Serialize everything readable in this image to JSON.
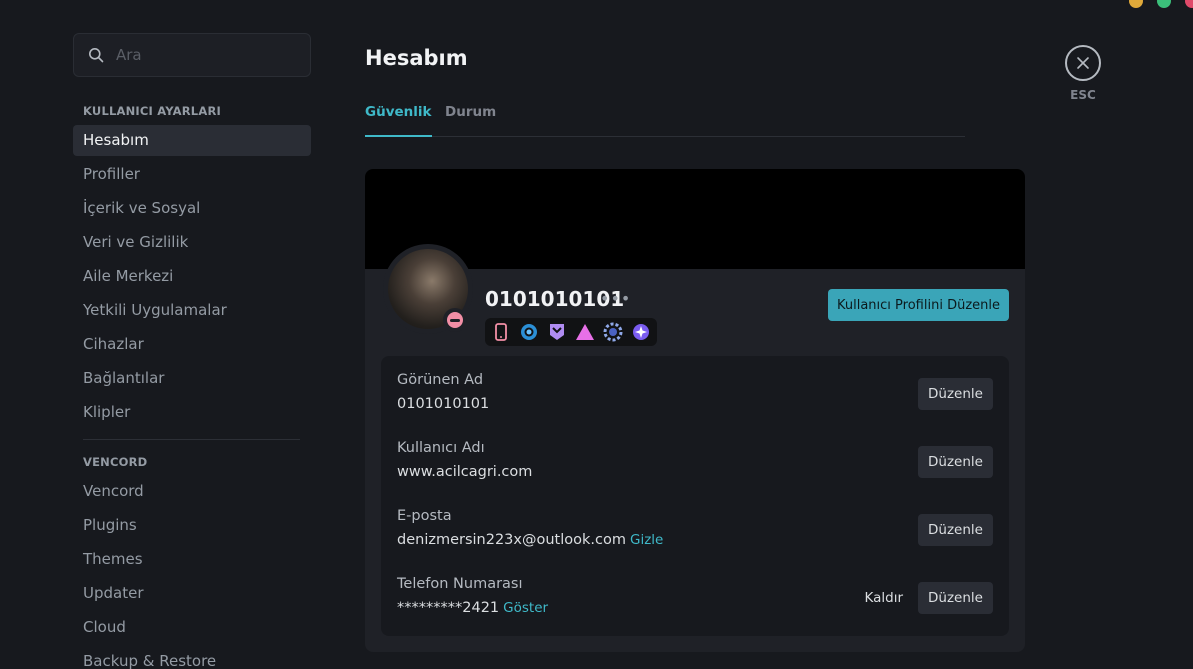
{
  "search": {
    "placeholder": "Ara"
  },
  "sidebar": {
    "user_settings_header": "KULLANICI AYARLARI",
    "user_items": [
      "Hesabım",
      "Profiller",
      "İçerik ve Sosyal",
      "Veri ve Gizlilik",
      "Aile Merkezi",
      "Yetkili Uygulamalar",
      "Cihazlar",
      "Bağlantılar",
      "Klipler"
    ],
    "vencord_header": "VENCORD",
    "vencord_items": [
      "Vencord",
      "Plugins",
      "Themes",
      "Updater",
      "Cloud",
      "Backup & Restore"
    ]
  },
  "main": {
    "title": "Hesabım",
    "tabs": [
      "Güvenlik",
      "Durum"
    ],
    "close_label": "ESC"
  },
  "profile": {
    "username": "0101010101",
    "more": "•••",
    "edit_profile_button": "Kullanıcı Profilini Düzenle",
    "badges": [
      "phone-badge-icon",
      "hypesquad-badge-icon",
      "nitro-badge-icon",
      "triangle-badge-icon",
      "gear-badge-icon",
      "quest-badge-icon"
    ]
  },
  "fields": {
    "display_name": {
      "label": "Görünen Ad",
      "value": "0101010101",
      "edit": "Düzenle"
    },
    "username": {
      "label": "Kullanıcı Adı",
      "value": "www.acilcagri.com",
      "edit": "Düzenle"
    },
    "email": {
      "label": "E-posta",
      "value": "denizmersin223x@outlook.com",
      "link": "Gizle",
      "edit": "Düzenle"
    },
    "phone": {
      "label": "Telefon Numarası",
      "value": "*********2421",
      "link": "Göster",
      "remove": "Kaldır",
      "edit": "Düzenle"
    }
  },
  "colors": {
    "accent": "#3fb9c9",
    "button": "#3aa5b8",
    "background": "#17191e",
    "card": "#1f2127",
    "status_dnd": "#f28fa6"
  }
}
